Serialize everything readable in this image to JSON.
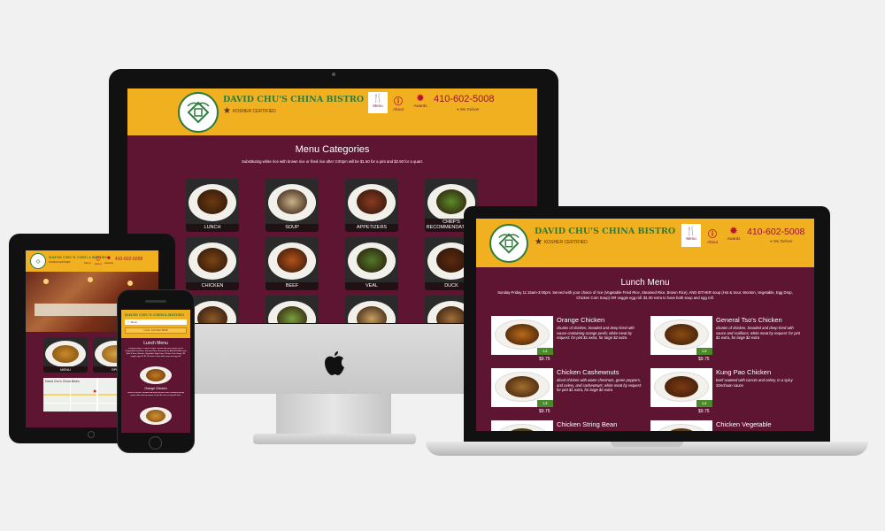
{
  "brand": {
    "name": "DAVID CHU'S CHINA BISTRO",
    "kosher": "KOSHER CERTIFIED",
    "phone": "410-602-5008",
    "location": "We Deliver"
  },
  "nav": {
    "menu": "Menu",
    "about": "About",
    "awards": "Awards"
  },
  "desktop": {
    "heading": "Menu Categories",
    "subtitle": "Substituting white rice with brown rice or fried rice after 3:00pm will be $1.50 for a pint and $2.50 for a quart.",
    "categories": [
      "LUNCH",
      "SOUP",
      "APPETIZERS",
      "CHEF'S RECOMMENDATIONS",
      "CHICKEN",
      "BEEF",
      "VEAL",
      "DUCK",
      "",
      "",
      "",
      ""
    ]
  },
  "laptop": {
    "heading": "Lunch Menu",
    "subtitle": "Sunday-Friday 11:15am-3:00pm. Served with your choice of rice (Vegetable Fried Rice, Steamed Rice, Brown Rice), AND EITHER soup (Hot & Sour, Wonton, Vegetable, Egg Drop, Chicken Corn Soup) OR veggie egg roll. $1.00 extra to have both soup and egg roll.",
    "items": [
      {
        "name": "Orange Chicken",
        "code": "L1",
        "price": "$9.75",
        "desc": "chunks of chicken, breaded and deep-fried with sauce containing orange peels; white meat by request: for pint $1 extra, for large $2 extra"
      },
      {
        "name": "General Tso's Chicken",
        "code": "L2",
        "price": "$9.75",
        "desc": "chunks of chicken, breaded and deep-fried with sauce and scallions; white meat by request: for pint $1 extra, for large $2 extra"
      },
      {
        "name": "Chicken Cashewnuts",
        "code": "L3",
        "price": "$9.75",
        "desc": "diced chicken with water chestnuts, green peppers, and celery, and cashewnuts; white meat by request: for pint $1 extra, for large $2 extra"
      },
      {
        "name": "Kung Pao Chicken",
        "code": "L4",
        "price": "$9.75",
        "desc": "beef sauteed with carrots and celery, in a spicy Szechuan sauce"
      },
      {
        "name": "Chicken String Bean",
        "code": "",
        "price": "",
        "desc": ""
      },
      {
        "name": "Chicken Vegetable",
        "code": "",
        "price": "",
        "desc": ""
      }
    ]
  },
  "tablet": {
    "tiles": [
      "MENU",
      "SPE"
    ],
    "map_label": "David Chu's China Bistro"
  },
  "phone": {
    "phone_bar": "CALL 410-602-5008",
    "heading": "Lunch Menu",
    "item_label": "Orange Chicken"
  },
  "colors": {
    "header": "#f1b01f",
    "body": "#5d1531",
    "brand_green": "#2f7b3c",
    "phone_red": "#9b1230"
  }
}
